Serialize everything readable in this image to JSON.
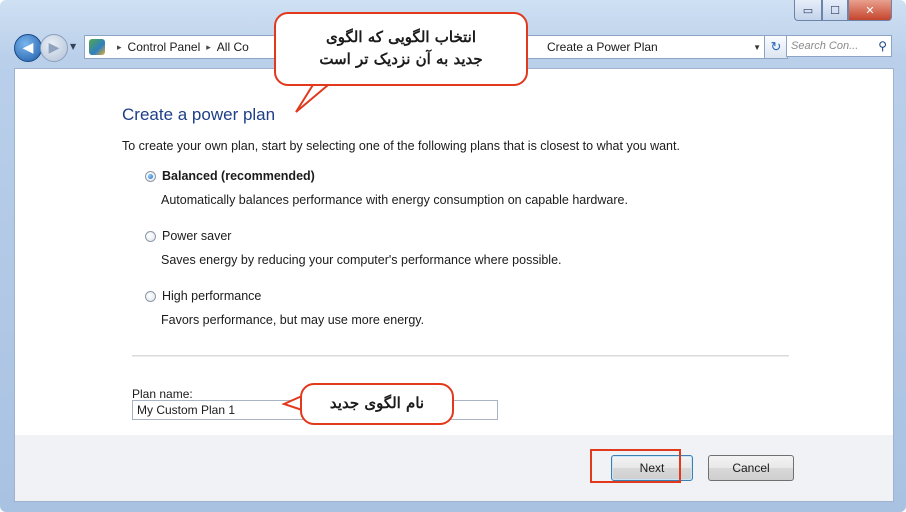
{
  "window": {
    "caption_buttons": {
      "minimize_glyph": "▭",
      "maximize_glyph": "☐",
      "close_glyph": "✕"
    },
    "close_button_color": "#c5452d"
  },
  "navbar": {
    "back_glyph": "◀",
    "forward_glyph": "▶",
    "breadcrumbs": [
      "Control Panel",
      "All Co",
      "Create a Power Plan"
    ],
    "crumb_separator": "▸",
    "refresh_glyph": "↻",
    "search_placeholder": "Search Con...",
    "search_icon": "search-icon"
  },
  "content": {
    "heading": "Create a power plan",
    "intro": "To create your own plan, start by selecting one of the following plans that is closest to what you want.",
    "options": [
      {
        "label": "Balanced (recommended)",
        "description": "Automatically balances performance with energy consumption on capable hardware.",
        "selected": true
      },
      {
        "label": "Power saver",
        "description": "Saves energy by reducing your computer's performance where possible.",
        "selected": false
      },
      {
        "label": "High performance",
        "description": "Favors performance, but may use more energy.",
        "selected": false
      }
    ],
    "plan_name_label": "Plan name:",
    "plan_name_value": "My Custom Plan 1"
  },
  "footer": {
    "next_label": "Next",
    "cancel_label": "Cancel"
  },
  "annotations": {
    "select_template_line1": "انتخاب الگویی که الگوی",
    "select_template_line2": "جدید به آن نزدیک تر است",
    "new_plan_name": "نام الگوی جدید",
    "color": "#e2391d"
  }
}
